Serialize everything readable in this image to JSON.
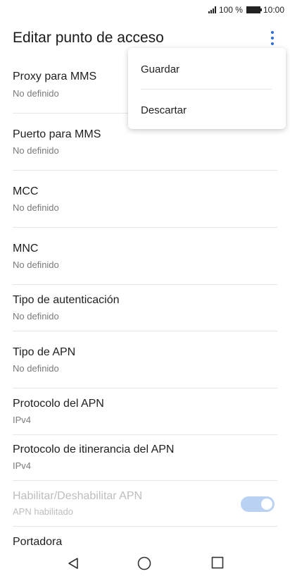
{
  "status_bar": {
    "battery": "100 %",
    "time": "10:00"
  },
  "app_bar": {
    "title": "Editar punto de acceso"
  },
  "menu": {
    "items": [
      {
        "label": "Guardar"
      },
      {
        "label": "Descartar"
      }
    ]
  },
  "settings": [
    {
      "title": "Proxy para MMS",
      "value": "No definido"
    },
    {
      "title": "Puerto para MMS",
      "value": "No definido"
    },
    {
      "title": "MCC",
      "value": "No definido"
    },
    {
      "title": "MNC",
      "value": "No definido"
    },
    {
      "title": "Tipo de autenticación",
      "value": "No definido"
    },
    {
      "title": "Tipo de APN",
      "value": "No definido"
    },
    {
      "title": "Protocolo del APN",
      "value": "IPv4"
    },
    {
      "title": "Protocolo de itinerancia del APN",
      "value": "IPv4"
    },
    {
      "title": "Habilitar/Deshabilitar APN",
      "value": "APN habilitado",
      "enabled": false,
      "toggle_on": true
    },
    {
      "title": "Portadora"
    }
  ],
  "navigation": {
    "back_icon": "back-triangle-icon",
    "home_icon": "home-circle-icon",
    "recents_icon": "recents-square-icon"
  },
  "colors": {
    "accent": "#2a6fdb",
    "toggle_track": "#b9d2f4",
    "secondary_text": "#7a7a7a",
    "disabled_text": "#bdbdbd"
  }
}
